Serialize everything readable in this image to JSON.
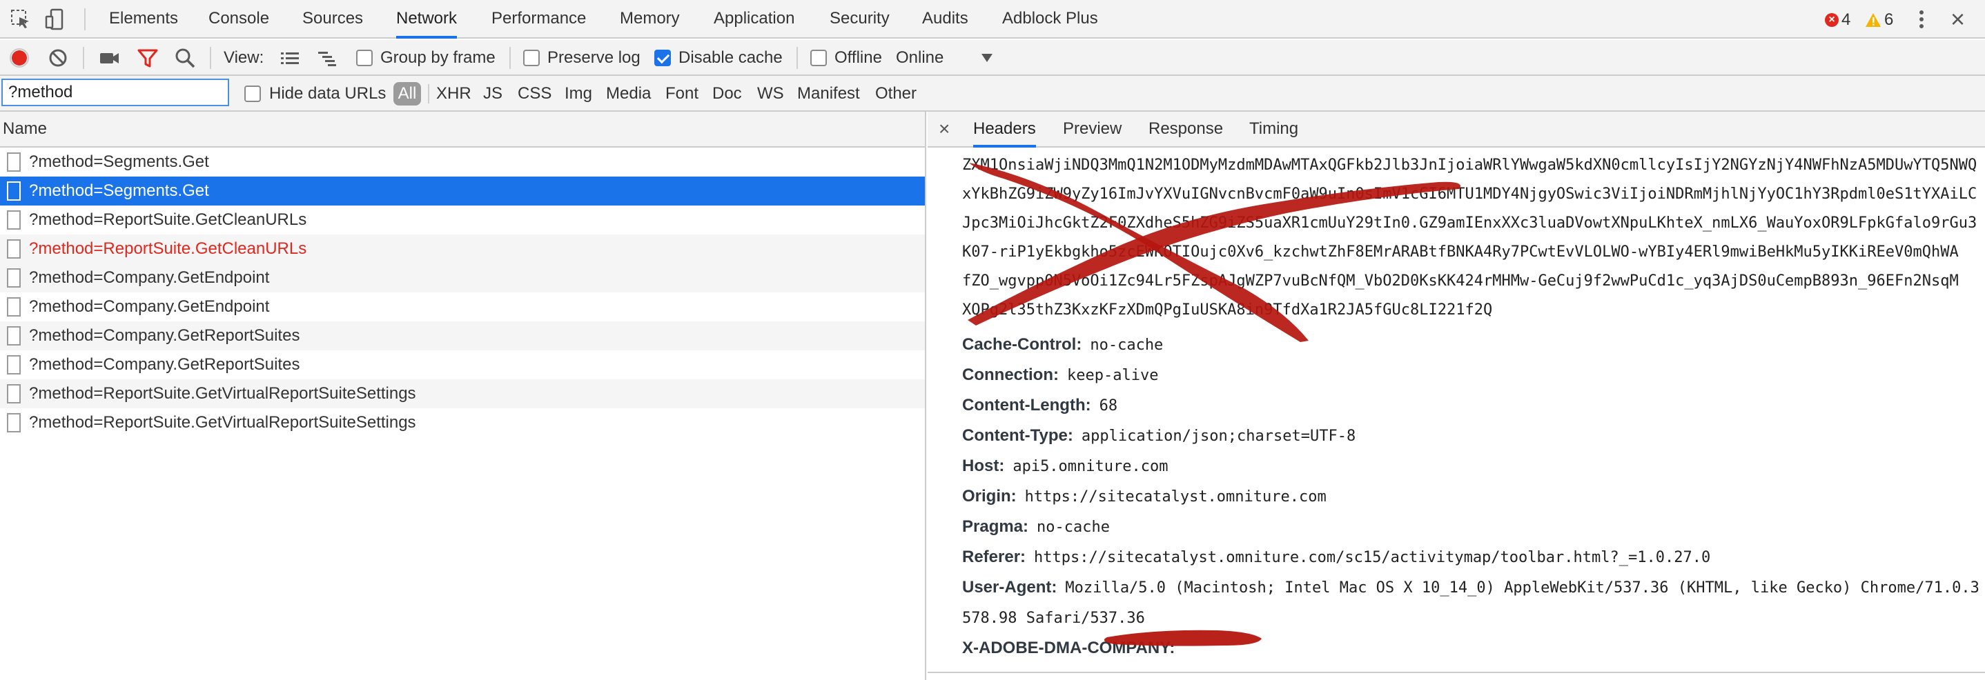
{
  "top_tabs": [
    "Elements",
    "Console",
    "Sources",
    "Network",
    "Performance",
    "Memory",
    "Application",
    "Security",
    "Audits",
    "Adblock Plus"
  ],
  "active_tab": "Network",
  "badges": {
    "errors": "4",
    "warnings": "6"
  },
  "toolbar": {
    "view_label": "View:",
    "group_by_frame": "Group by frame",
    "preserve_log": "Preserve log",
    "disable_cache": "Disable cache",
    "offline": "Offline",
    "throttling": "Online"
  },
  "filter": {
    "value": "?method",
    "hide_data_urls": "Hide data URLs",
    "types": [
      "All",
      "XHR",
      "JS",
      "CSS",
      "Img",
      "Media",
      "Font",
      "Doc",
      "WS",
      "Manifest",
      "Other"
    ]
  },
  "list": {
    "header": "Name",
    "rows": [
      {
        "name": "?method=Segments.Get",
        "state": "normal"
      },
      {
        "name": "?method=Segments.Get",
        "state": "selected"
      },
      {
        "name": "?method=ReportSuite.GetCleanURLs",
        "state": "normal"
      },
      {
        "name": "?method=ReportSuite.GetCleanURLs",
        "state": "error"
      },
      {
        "name": "?method=Company.GetEndpoint",
        "state": "normal"
      },
      {
        "name": "?method=Company.GetEndpoint",
        "state": "normal"
      },
      {
        "name": "?method=Company.GetReportSuites",
        "state": "normal"
      },
      {
        "name": "?method=Company.GetReportSuites",
        "state": "normal"
      },
      {
        "name": "?method=ReportSuite.GetVirtualReportSuiteSettings",
        "state": "normal"
      },
      {
        "name": "?method=ReportSuite.GetVirtualReportSuiteSettings",
        "state": "normal"
      }
    ]
  },
  "detail": {
    "close": "×",
    "tabs": [
      "Headers",
      "Preview",
      "Response",
      "Timing"
    ],
    "active_tab": "Headers",
    "token_lines": [
      "ZXM1OnsiaWjiNDQ3MmQ1N2M1ODMyMzdmMDAwMTAxQGFkb2Jlb3JnIjoiaWRlYWwgaW5kdXN0cmllcyIsIjY2NGYzNjY4NWFhNzA5MDUwYTQ5NWQ",
      "xYkBhZG9iZW9yZy16ImJvYXVuIGNvcnBvcmF0aW9uIn0sImV1cGI6MTU1MDY4NjgyOSwic3ViIjoiNDRmMjhlNjYyOC1hY3Rpdml0eS1tYXAiLC",
      "Jpc3MiOiJhcGktZ2F0ZXdheS5hZG9iZS5uaXR1cmUuY29tIn0.GZ9amIEnxXXc3luaDVowtXNpuLKhteX_nmLX6_WauYoxOR9LFpkGfalo9rGu3",
      "K07-riP1yEkbgkho5zcEWKOTIOujc0Xv6_kzchwtZhF8EMrARABtfBNKA4Ry7PCwtEvVLOLWO-wYBIy4ERl9mwiBeHkMu5yIKKiREeV0mQhWA",
      "fZO_wgvpp0N5VoOi1Zc94Lr5FZspAJgWZP7vuBcNfQM_VbO2D0KsKK424rMHMw-GeCuj9f2wwPuCd1c_yq3AjDS0uCempB893n_96EFn2NsqM",
      "XQPg2l35thZ3KxzKFzXDmQPgIuUSKA8in9TfdXa1R2JA5fGUc8LI221f2Q"
    ],
    "headers": [
      {
        "key": "Cache-Control:",
        "value": "no-cache"
      },
      {
        "key": "Connection:",
        "value": "keep-alive"
      },
      {
        "key": "Content-Length:",
        "value": "68"
      },
      {
        "key": "Content-Type:",
        "value": "application/json;charset=UTF-8"
      },
      {
        "key": "Host:",
        "value": "api5.omniture.com"
      },
      {
        "key": "Origin:",
        "value": "https://sitecatalyst.omniture.com"
      },
      {
        "key": "Pragma:",
        "value": "no-cache"
      },
      {
        "key": "Referer:",
        "value": "https://sitecatalyst.omniture.com/sc15/activitymap/toolbar.html?_=1.0.27.0"
      },
      {
        "key": "User-Agent:",
        "value": "Mozilla/5.0 (Macintosh; Intel Mac OS X 10_14_0) AppleWebKit/537.36 (KHTML, like Gecko) Chrome/71.0.3"
      },
      {
        "key": "",
        "value": "578.98 Safari/537.36"
      },
      {
        "key": "X-ADOBE-DMA-COMPANY:",
        "value": ""
      }
    ]
  },
  "colors": {
    "accent": "#1a73e8",
    "error": "#e0281f",
    "warning": "#f4b400",
    "redaction": "#b5160f"
  }
}
